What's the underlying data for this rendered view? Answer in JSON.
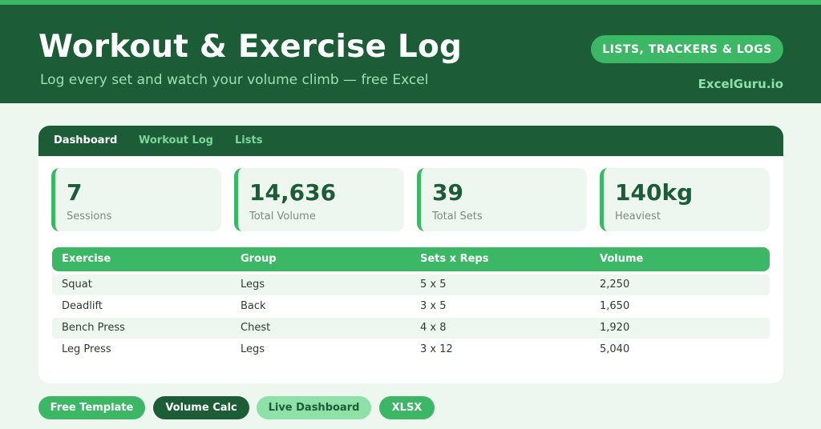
{
  "header": {
    "title": "Workout & Exercise Log",
    "subtitle": "Log every set and watch your volume climb — free Excel",
    "category_pill": "LISTS, TRACKERS & LOGS",
    "brand": "ExcelGuru.io"
  },
  "tabs": [
    {
      "label": "Dashboard",
      "active": true
    },
    {
      "label": "Workout Log",
      "active": false
    },
    {
      "label": "Lists",
      "active": false
    }
  ],
  "stats": [
    {
      "value": "7",
      "label": "Sessions"
    },
    {
      "value": "14,636",
      "label": "Total Volume"
    },
    {
      "value": "39",
      "label": "Total Sets"
    },
    {
      "value": "140kg",
      "label": "Heaviest"
    }
  ],
  "table": {
    "columns": [
      "Exercise",
      "Group",
      "Sets x Reps",
      "Volume"
    ],
    "rows": [
      [
        "Squat",
        "Legs",
        "5 x 5",
        "2,250"
      ],
      [
        "Deadlift",
        "Back",
        "3 x 5",
        "1,650"
      ],
      [
        "Bench Press",
        "Chest",
        "4 x 8",
        "1,920"
      ],
      [
        "Leg Press",
        "Legs",
        "3 x 12",
        "5,040"
      ]
    ]
  },
  "chips": [
    {
      "label": "Free Template"
    },
    {
      "label": "Volume Calc"
    },
    {
      "label": "Live Dashboard"
    },
    {
      "label": "XLSX"
    }
  ],
  "colors": {
    "dark_green": "#1c5c36",
    "accent_green": "#3cb765",
    "light_green": "#8fe0a9",
    "background": "#eef7ef"
  }
}
